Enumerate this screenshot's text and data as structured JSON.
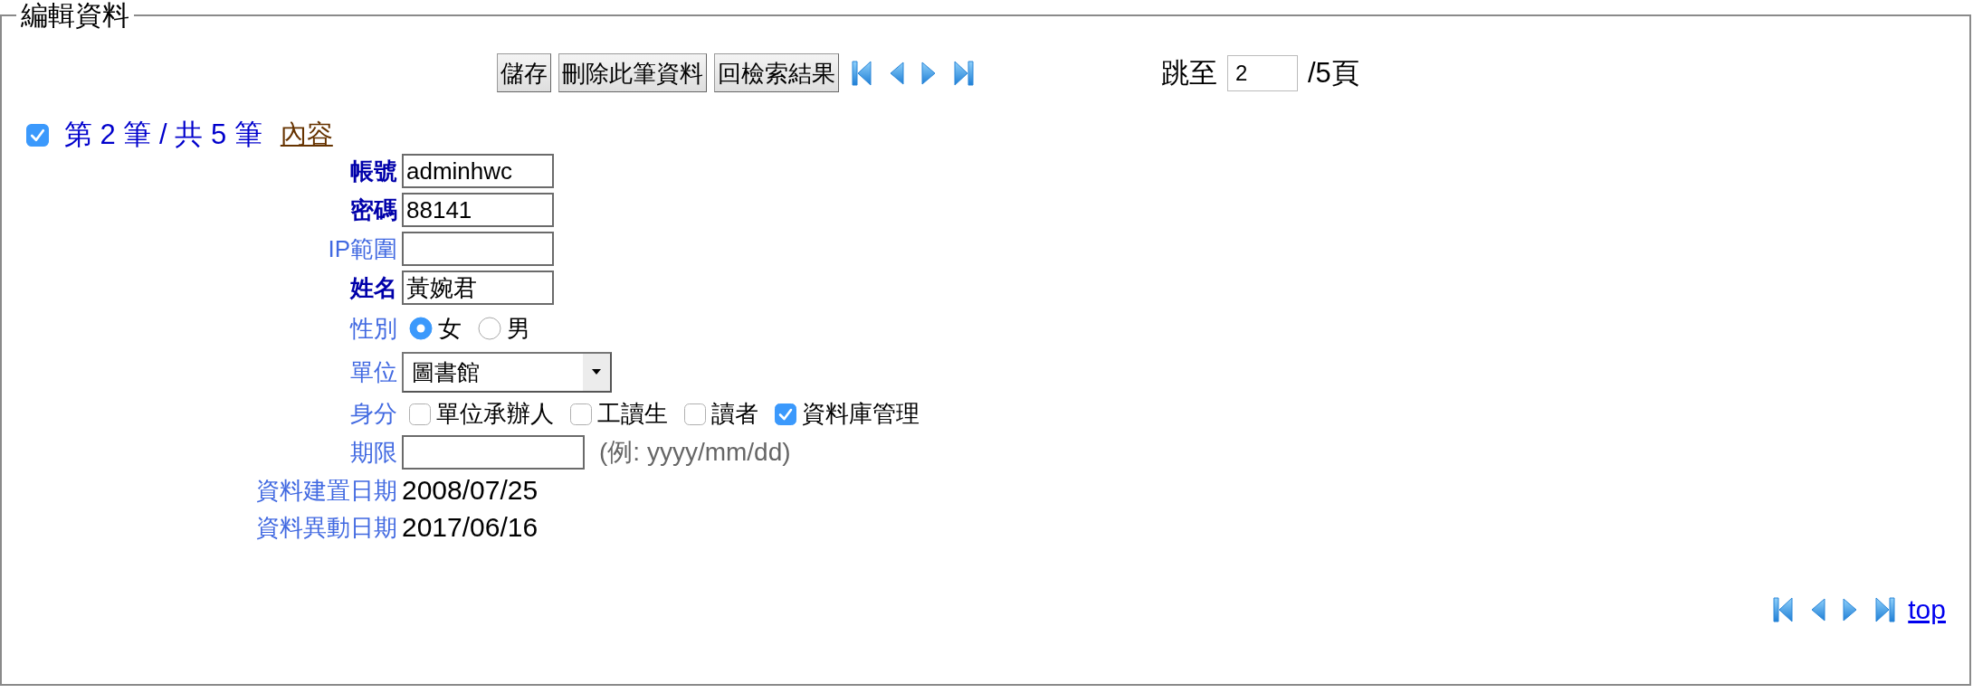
{
  "fieldset": {
    "legend": "編輯資料"
  },
  "toolbar": {
    "buttons": [
      {
        "label": "儲存"
      },
      {
        "label": "刪除此筆資料"
      },
      {
        "label": "回檢索結果"
      }
    ],
    "jump": {
      "label": "跳至",
      "value": "2",
      "suffix": "/5頁"
    }
  },
  "record": {
    "checked": true,
    "position": "第 2 筆 / 共 5 筆",
    "link": "內容"
  },
  "fields": [
    {
      "label": "帳號",
      "required": true,
      "kind": "text",
      "value": "adminhwc"
    },
    {
      "label": "密碼",
      "required": true,
      "kind": "text",
      "value": "88141"
    },
    {
      "label": "IP範圍",
      "required": false,
      "kind": "text"
    },
    {
      "label": "姓名",
      "required": true,
      "kind": "text",
      "value": "黃婉君"
    },
    {
      "label": "性別",
      "required": false,
      "kind": "radio",
      "options": [
        {
          "label": "女",
          "selected": true
        },
        {
          "label": "男",
          "selected": false
        }
      ]
    },
    {
      "label": "單位",
      "required": false,
      "kind": "select",
      "value": "圖書館"
    },
    {
      "label": "身分",
      "required": false,
      "kind": "checkboxes",
      "options": [
        {
          "label": "單位承辦人",
          "checked": false
        },
        {
          "label": "工讀生",
          "checked": false
        },
        {
          "label": "讀者",
          "checked": false
        },
        {
          "label": "資料庫管理",
          "checked": true
        }
      ]
    },
    {
      "label": "期限",
      "required": false,
      "kind": "date",
      "hint": "(例: yyyy/mm/dd)"
    },
    {
      "label": "資料建置日期",
      "required": false,
      "kind": "display",
      "value": "2008/07/25"
    },
    {
      "label": "資料異動日期",
      "required": false,
      "kind": "display",
      "value": "2017/06/16"
    }
  ],
  "bottom_nav": {
    "link": "top"
  }
}
